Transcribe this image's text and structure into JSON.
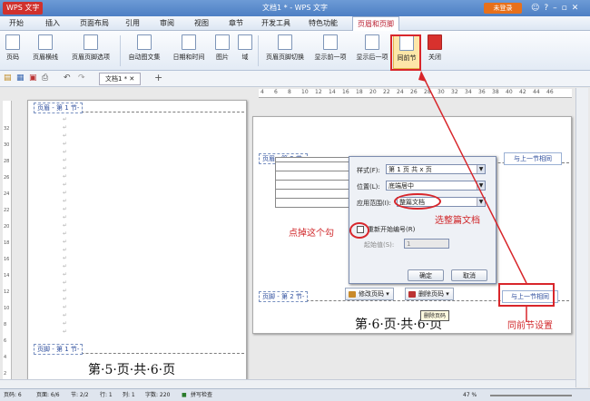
{
  "titlebar": {
    "app": "WPS 文字",
    "doc": "文档1 * - WPS 文字",
    "login": "未登录"
  },
  "menu": [
    "开始",
    "插入",
    "页面布局",
    "引用",
    "审阅",
    "视图",
    "章节",
    "开发工具",
    "特色功能",
    "页眉和页脚"
  ],
  "ribbon": {
    "buttons": [
      "页码",
      "页眉横线",
      "页眉页脚选项",
      "自动图文集",
      "日期和时间",
      "图片",
      "域",
      "页眉页脚切换",
      "显示前一项",
      "显示后一项",
      "同前节",
      "关闭"
    ]
  },
  "doc_tab": "文档1 *",
  "ruler_ticks": [
    "4",
    "6",
    "8",
    "10",
    "12",
    "14",
    "16",
    "18",
    "20",
    "22",
    "24",
    "26",
    "28",
    "30",
    "32",
    "34",
    "36",
    "38",
    "40",
    "42",
    "44",
    "46"
  ],
  "vruler_ticks": [
    "32",
    "30",
    "28",
    "26",
    "24",
    "22",
    "20",
    "18",
    "16",
    "14",
    "12",
    "10",
    "8",
    "6",
    "4",
    "2"
  ],
  "left_page": {
    "header_tag": "页眉 - 第 1 节-",
    "footer_tag": "页脚 - 第 1 节-",
    "footer": "第·5·页·共·6·页"
  },
  "right_page": {
    "header_tag": "页眉 - 第 2 节-",
    "footer_tag": "页脚 - 第 2 节-",
    "same_as_prev": "与上一节相同",
    "footer": "第·6·页·共·6·页"
  },
  "dialog": {
    "style_label": "样式(F):",
    "style_value": "第 1 页 共 x 页",
    "position_label": "位置(L):",
    "position_value": "底端居中",
    "scope_label": "应用范围(I):",
    "scope_value": "整篇文档",
    "restart_label": "重新开始编号(R)",
    "start_label": "起始值(S):",
    "start_value": "1",
    "ok": "确定",
    "cancel": "取消"
  },
  "float_buttons": {
    "modify": "修改页码",
    "delete": "删除页码",
    "tooltip": "删除页码"
  },
  "annotations": {
    "select_doc": "选整篇文档",
    "uncheck": "点掉这个勾",
    "same_section": "同前节设置"
  },
  "status": {
    "page": "页码: 6",
    "pages": "页面: 6/6",
    "section": "节: 2/2",
    "row": "行: 1",
    "col": "列: 1",
    "words": "字数: 220",
    "spell": "拼写检查",
    "zoom": "47 %"
  }
}
